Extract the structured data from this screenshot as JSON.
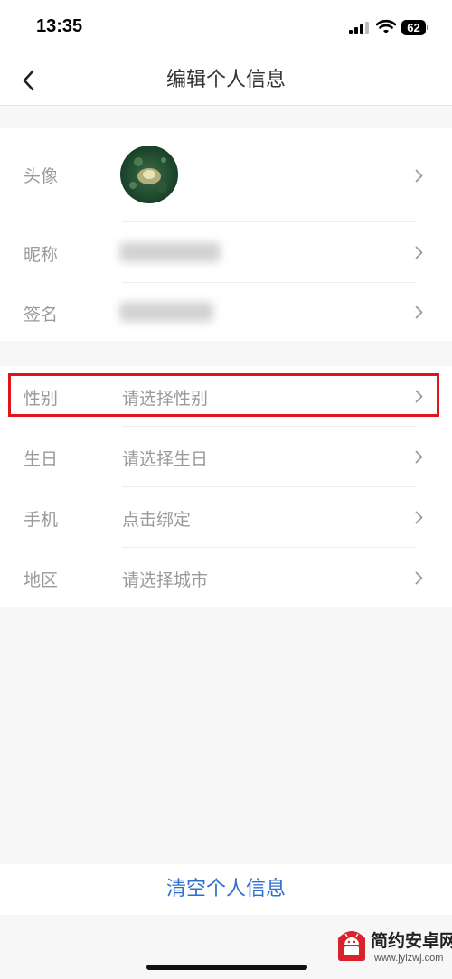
{
  "status_bar": {
    "time": "13:35",
    "battery": "62"
  },
  "header": {
    "title": "编辑个人信息"
  },
  "profile_section": {
    "avatar_label": "头像",
    "nickname_label": "昵称",
    "signature_label": "签名"
  },
  "detail_section": {
    "rows": [
      {
        "label": "性别",
        "value": "请选择性别"
      },
      {
        "label": "生日",
        "value": "请选择生日"
      },
      {
        "label": "手机",
        "value": "点击绑定"
      },
      {
        "label": "地区",
        "value": "请选择城市"
      }
    ]
  },
  "footer": {
    "clear_label": "清空个人信息"
  },
  "watermark": {
    "text": "简约安卓网",
    "url": "www.jylzwj.com"
  },
  "colors": {
    "highlight": "#e0141b",
    "link": "#2f6fd0",
    "label": "#9a9a9a"
  },
  "icons": {
    "back": "chevron-left-icon",
    "row_arrow": "chevron-right-icon"
  }
}
